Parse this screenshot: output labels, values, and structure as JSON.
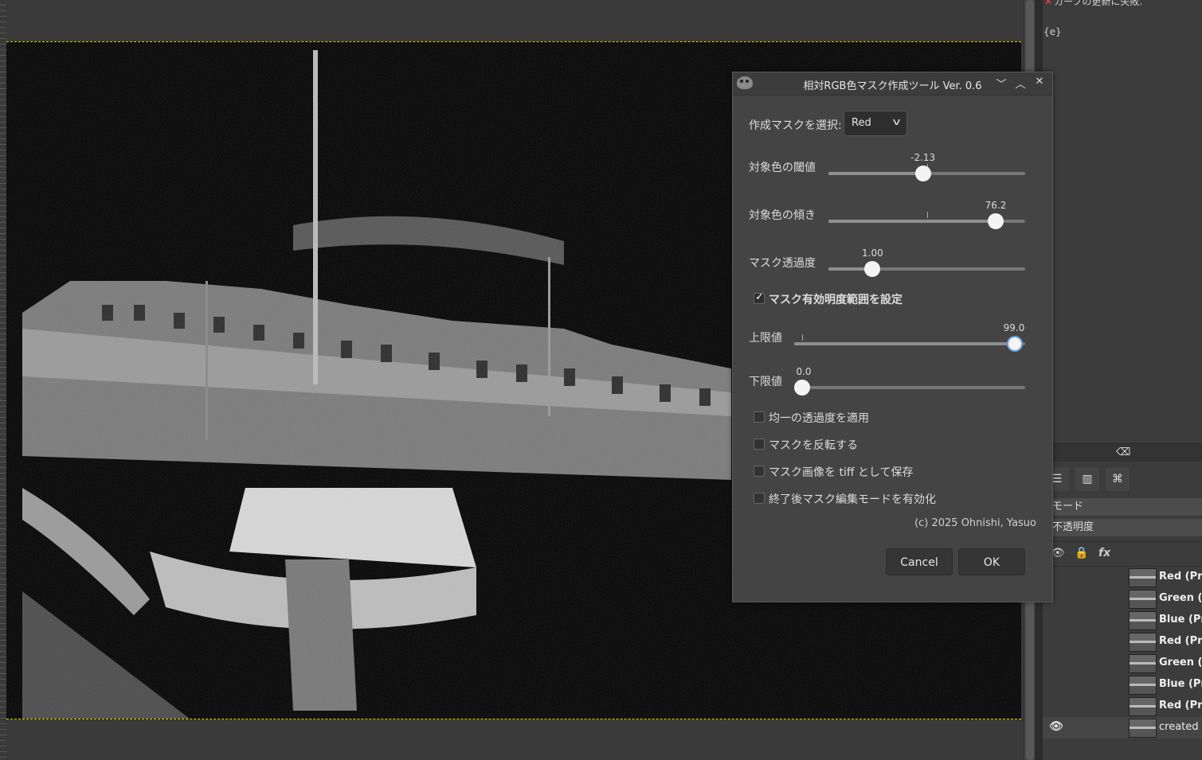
{
  "right_panel": {
    "error_message": "カーブの更新に失敗.",
    "error_code": "{e}",
    "mode_label": "モード",
    "opacity_label": "不透明度",
    "layers": [
      {
        "name": "Red (Prv"
      },
      {
        "name": "Green (P"
      },
      {
        "name": "Blue (Prv"
      },
      {
        "name": "Red (Prv"
      },
      {
        "name": "Green (P"
      },
      {
        "name": "Blue (Prv"
      },
      {
        "name": "Red (Prv"
      },
      {
        "name": "created r"
      }
    ]
  },
  "dialog": {
    "title": "相対RGB色マスク作成ツール Ver. 0.6",
    "mask_select_label": "作成マスクを選択:",
    "mask_select_value": "Red",
    "threshold": {
      "label": "対象色の閾値",
      "value_text": "-2.13",
      "value": -2.13
    },
    "slope": {
      "label": "対象色の傾き",
      "value_text": "76.2",
      "value": 76.2
    },
    "mask_opacity": {
      "label": "マスク透過度",
      "value_text": "1.00",
      "value": 1.0
    },
    "brightness_range_checkbox": {
      "label": "マスク有効明度範囲を設定",
      "checked": true
    },
    "upper": {
      "label": "上限値",
      "value_text": "99.0",
      "value": 99.0
    },
    "lower": {
      "label": "下限値",
      "value_text": "0.0",
      "value": 0.0
    },
    "options": [
      {
        "label": "均一の透過度を適用",
        "checked": false
      },
      {
        "label": "マスクを反転する",
        "checked": false
      },
      {
        "label": "マスク画像を tiff として保存",
        "checked": false
      },
      {
        "label": "終了後マスク編集モードを有効化",
        "checked": false
      }
    ],
    "copyright": "(c) 2025 Ohnishi, Yasuo",
    "cancel_label": "Cancel",
    "ok_label": "OK"
  }
}
